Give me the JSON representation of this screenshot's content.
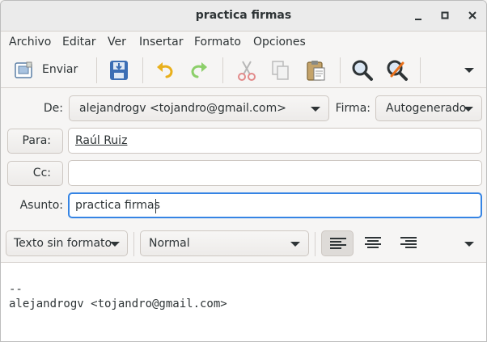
{
  "window": {
    "title": "practica firmas",
    "minimize": "–",
    "maximize": "□",
    "close": "✕"
  },
  "menubar": [
    "Archivo",
    "Editar",
    "Ver",
    "Insertar",
    "Formato",
    "Opciones"
  ],
  "toolbar": {
    "send_label": "Enviar",
    "icons": [
      "compose-icon",
      "save-draft-icon",
      "undo-icon",
      "redo-icon",
      "cut-icon",
      "copy-icon",
      "paste-icon",
      "find-icon",
      "replace-icon",
      "overflow-icon"
    ]
  },
  "header": {
    "from_label": "De:",
    "from_value": "alejandrogv <tojandro@gmail.com>",
    "signature_label": "Firma:",
    "signature_value": "Autogenerado",
    "to_label": "Para:",
    "to_value": "Raúl Ruiz",
    "cc_label": "Cc:",
    "cc_value": "",
    "subject_label": "Asunto:",
    "subject_value": "practica firmas"
  },
  "format": {
    "text_format": "Texto sin formato",
    "paragraph_style": "Normal",
    "alignment_active": "left"
  },
  "body": {
    "line1": "",
    "line2": "--",
    "line3": "alejandrogv <tojandro@gmail.com>"
  }
}
